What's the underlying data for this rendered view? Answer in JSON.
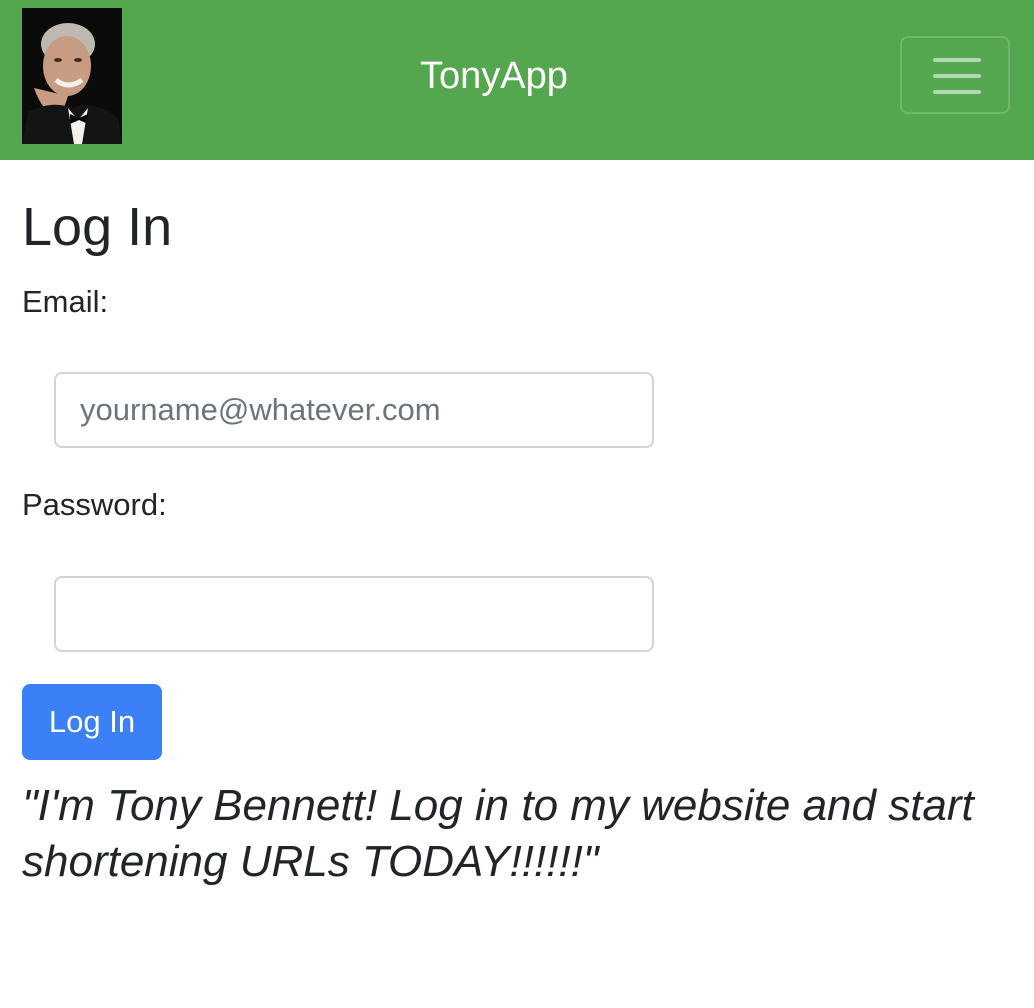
{
  "navbar": {
    "brand_title": "TonyApp",
    "brand_image": "tony-bennett-photo",
    "menu_icon": "hamburger-menu-icon",
    "background_color": "#54a74f"
  },
  "login": {
    "title": "Log In",
    "email_label": "Email:",
    "email_placeholder": "yourname@whatever.com",
    "email_value": "",
    "password_label": "Password:",
    "password_value": "",
    "submit_label": "Log In",
    "submit_color": "#3b80f6"
  },
  "tagline": "\"I'm Tony Bennett! Log in to my website and start shortening URLs TODAY!!!!!!\""
}
